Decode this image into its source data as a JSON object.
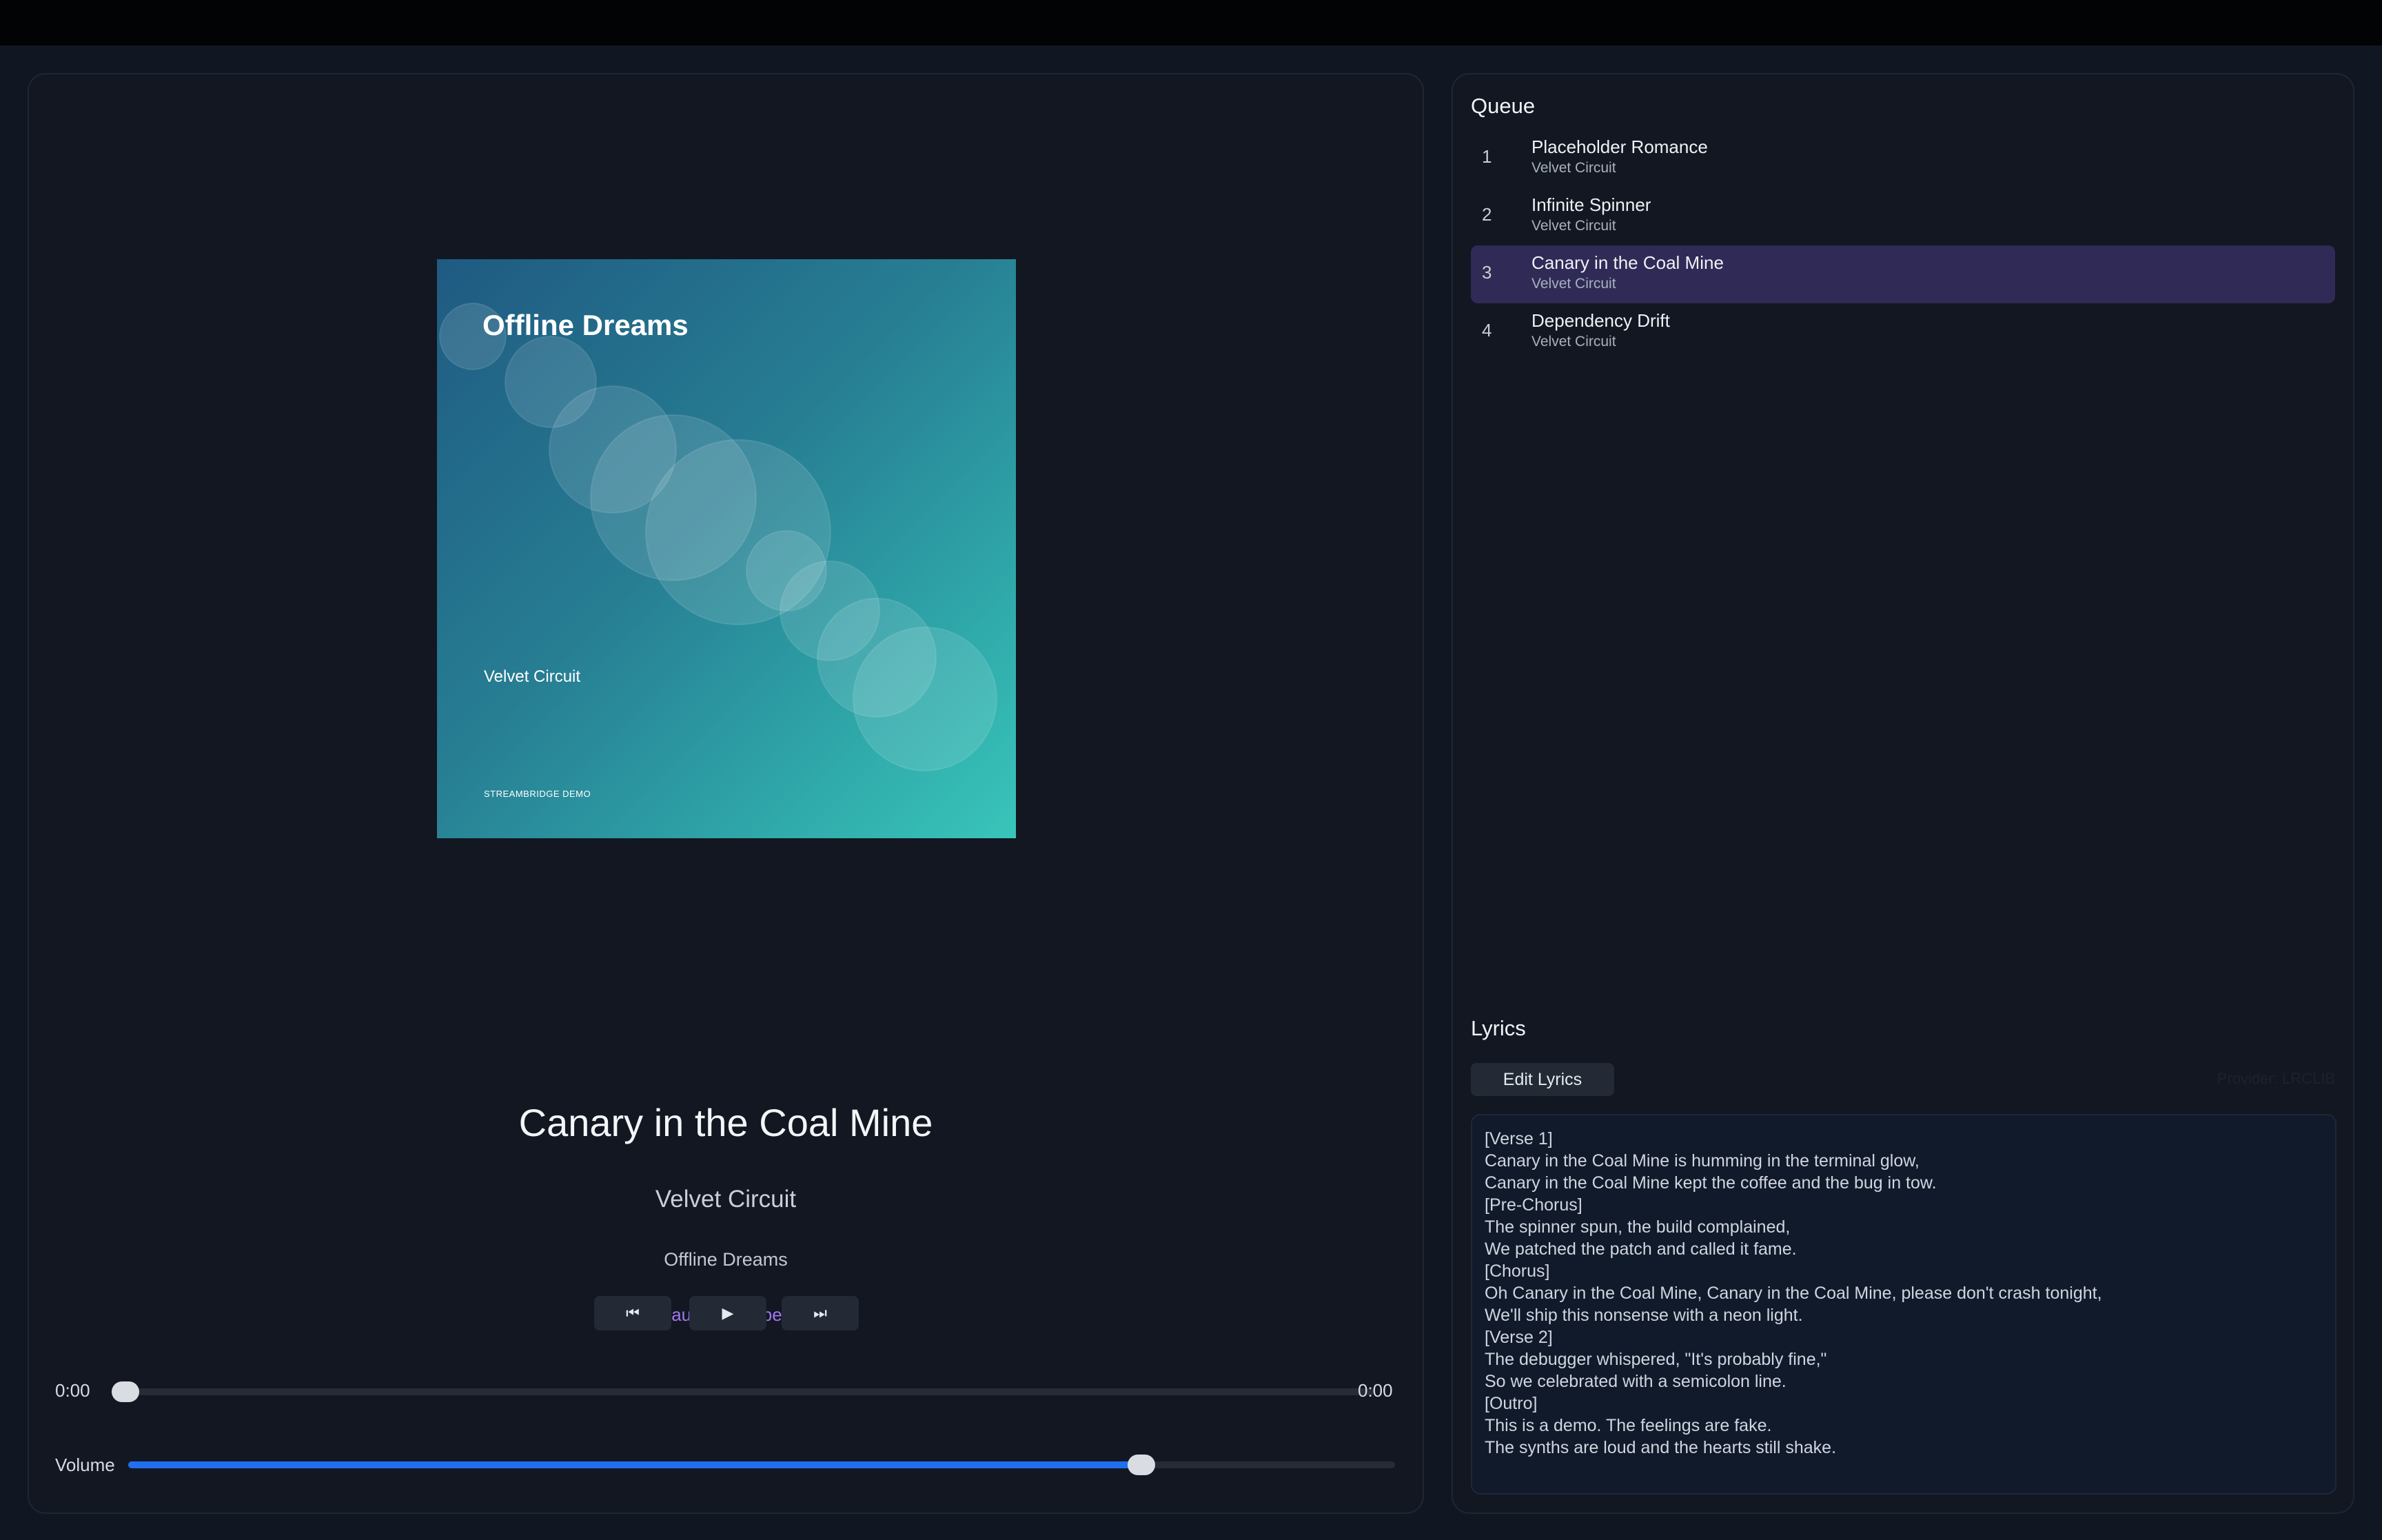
{
  "player": {
    "album_art": {
      "title": "Offline Dreams",
      "artist": "Velvet Circuit",
      "label": "STREAMBRIDGE DEMO"
    },
    "track_title": "Canary in the Coal Mine",
    "artist": "Velvet Circuit",
    "album": "Offline Dreams",
    "status": "Paused/Stopped",
    "controls": {
      "prev_icon": "⏮",
      "play_icon": "▶",
      "next_icon": "⏭"
    },
    "time_current": "0:00",
    "time_duration": "0:00",
    "progress": 0,
    "volume_label": "Volume",
    "volume": 0.8
  },
  "queue": {
    "heading": "Queue",
    "items": [
      {
        "num": "1",
        "title": "Placeholder Romance",
        "artist": "Velvet Circuit",
        "active": false
      },
      {
        "num": "2",
        "title": "Infinite Spinner",
        "artist": "Velvet Circuit",
        "active": false
      },
      {
        "num": "3",
        "title": "Canary in the Coal Mine",
        "artist": "Velvet Circuit",
        "active": true
      },
      {
        "num": "4",
        "title": "Dependency Drift",
        "artist": "Velvet Circuit",
        "active": false
      }
    ]
  },
  "lyrics": {
    "heading": "Lyrics",
    "edit_label": "Edit Lyrics",
    "provider": "Provider: LRCLIB",
    "lines": [
      "[Verse 1]",
      "Canary in the Coal Mine is humming in the terminal glow,",
      "Canary in the Coal Mine kept the coffee and the bug in tow.",
      "[Pre-Chorus]",
      "The spinner spun, the build complained,",
      "We patched the patch and called it fame.",
      "[Chorus]",
      "Oh Canary in the Coal Mine, Canary in the Coal Mine, please don't crash tonight,",
      "We'll ship this nonsense with a neon light.",
      "[Verse 2]",
      "The debugger whispered, \"It's probably fine,\"",
      "So we celebrated with a semicolon line.",
      "[Outro]",
      "This is a demo. The feelings are fake.",
      "The synths are loud and the hearts still shake."
    ]
  },
  "colors": {
    "accent": "#1f6ff0",
    "status": "#a277f0",
    "active_row": "#2f2a56"
  }
}
